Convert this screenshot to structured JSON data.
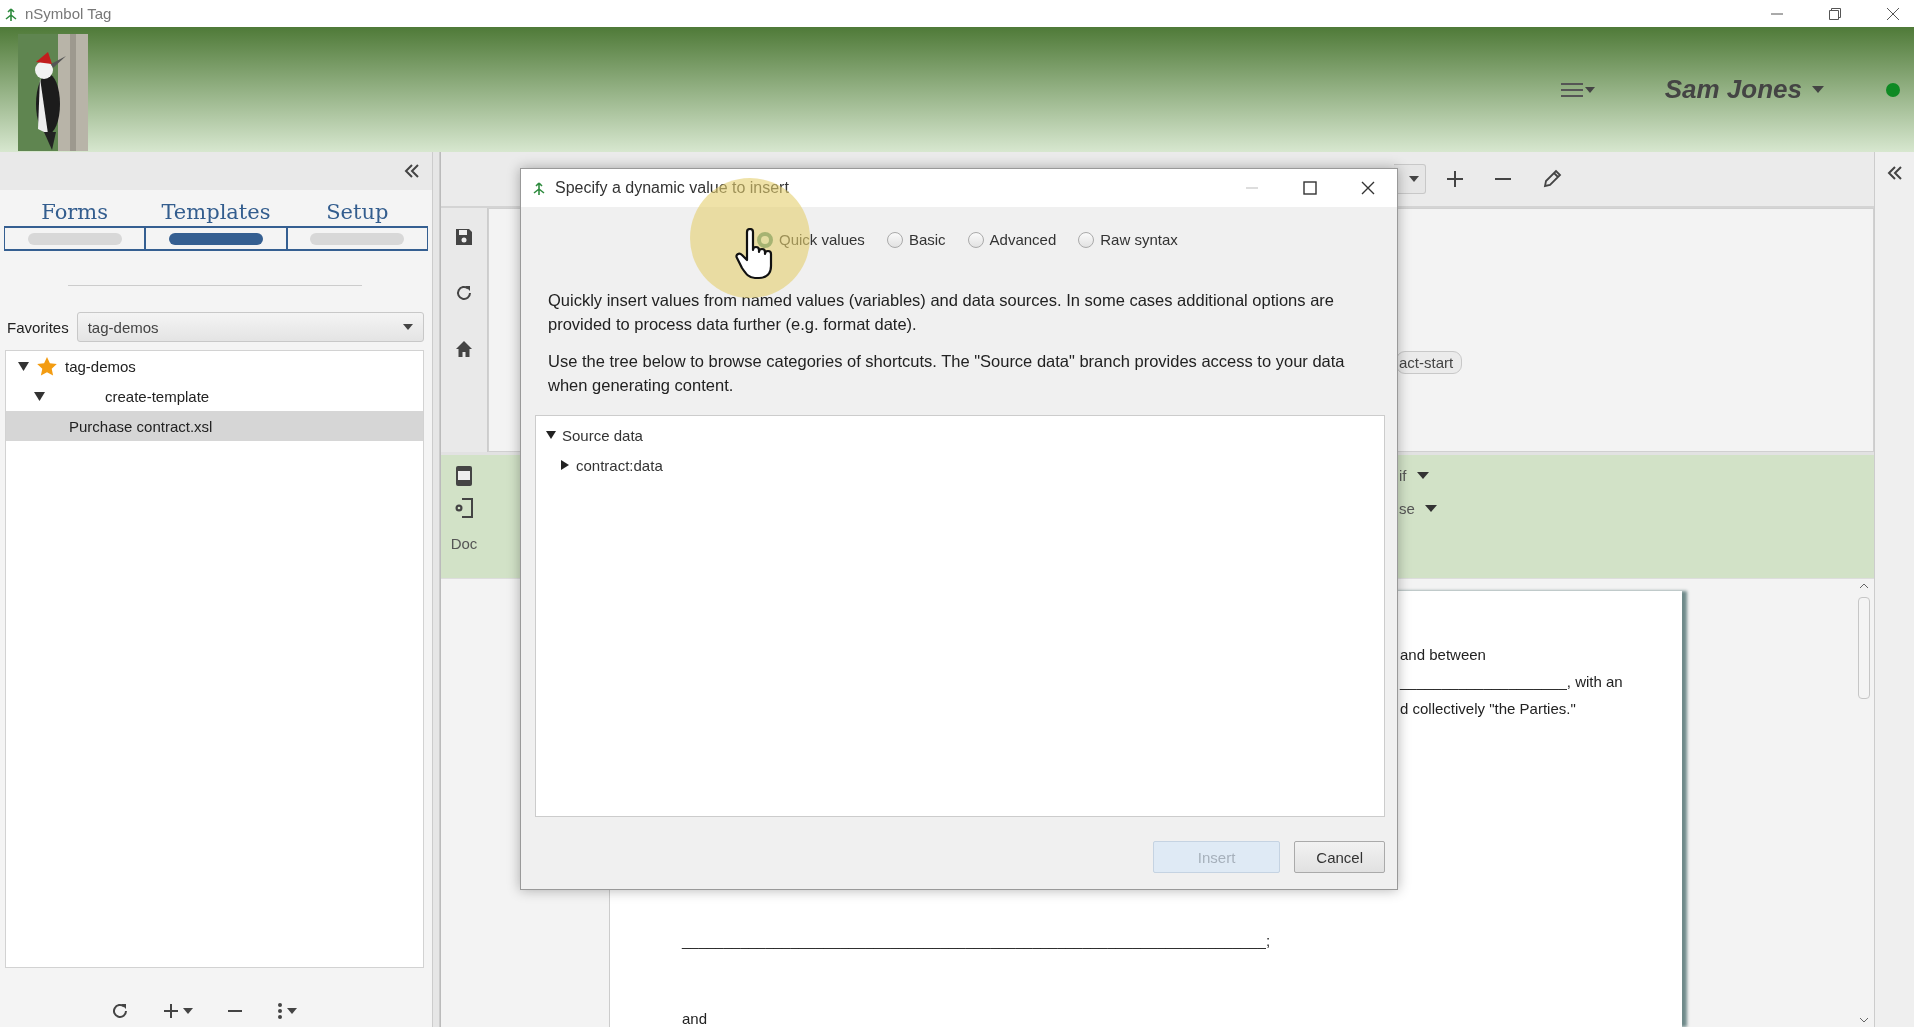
{
  "window": {
    "title": "nSymbol Tag"
  },
  "header": {
    "user": "Sam Jones",
    "online": true
  },
  "left_panel": {
    "tabs": [
      {
        "label": "Forms",
        "selected": false
      },
      {
        "label": "Templates",
        "selected": true
      },
      {
        "label": "Setup",
        "selected": false
      }
    ],
    "favorites": {
      "label": "Favorites",
      "value": "tag-demos"
    },
    "tree": [
      {
        "label": "tag-demos",
        "kind": "favorite",
        "expanded": true,
        "selected": false,
        "children": [
          {
            "label": "create-template",
            "expanded": true,
            "selected": false,
            "children": [
              {
                "label": "Purchase contract.xsl",
                "selected": true
              }
            ]
          }
        ]
      }
    ]
  },
  "editor": {
    "tag": "act-start",
    "conditions": [
      "if",
      "se"
    ],
    "side_label": "Doc",
    "document_lines": [
      "and between",
      "____________________, with an",
      "d collectively \"the Parties.\""
    ],
    "document_lower": [
      "______________________________________________________________________;",
      "and"
    ]
  },
  "dialog": {
    "title": "Specify a dynamic value to insert",
    "options": [
      {
        "label": "Quick values",
        "selected": true
      },
      {
        "label": "Basic",
        "selected": false
      },
      {
        "label": "Advanced",
        "selected": false
      },
      {
        "label": "Raw syntax",
        "selected": false
      }
    ],
    "paragraphs": [
      "Quickly insert values from named values (variables) and data sources. In some cases additional options are provided to process data further (e.g. format date).",
      "Use the tree below to browse categories of shortcuts. The \"Source data\" branch provides access to your data when generating content."
    ],
    "tree": [
      {
        "label": "Source data",
        "expanded": true,
        "children": [
          {
            "label": "contract:data",
            "expanded": false
          }
        ]
      }
    ],
    "buttons": [
      {
        "label": "Insert",
        "disabled": true
      },
      {
        "label": "Cancel",
        "disabled": false
      }
    ]
  }
}
